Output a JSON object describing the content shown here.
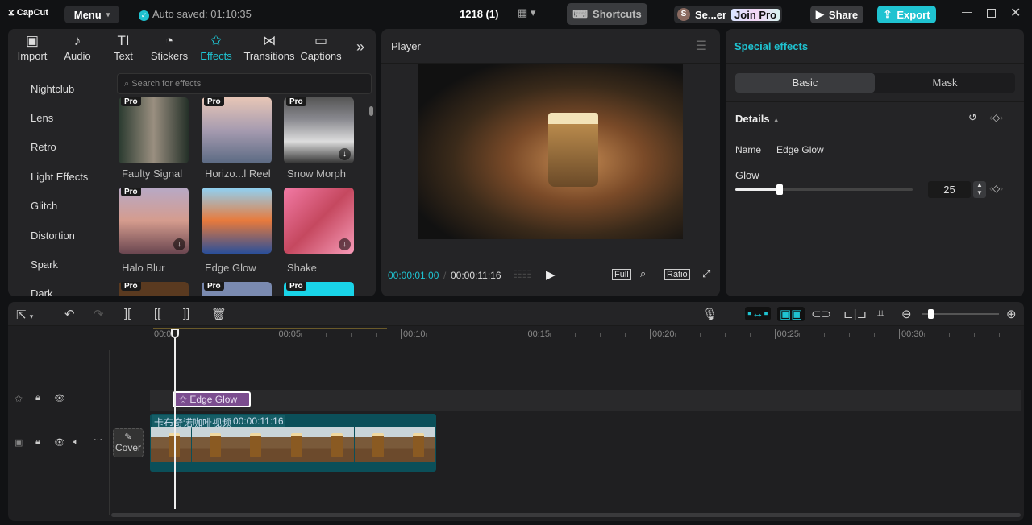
{
  "app": {
    "logo": "CapCut",
    "menu": "Menu",
    "autosave": "Auto saved: 01:10:35",
    "project": "1218 (1)",
    "shortcuts": "Shortcuts",
    "user_initial": "S",
    "user": "Se...er",
    "join_pro": "Join Pro",
    "share": "Share",
    "export": "Export"
  },
  "tabs": [
    {
      "label": "Import",
      "icon": "import-icon"
    },
    {
      "label": "Audio",
      "icon": "audio-icon"
    },
    {
      "label": "Text",
      "icon": "text-icon"
    },
    {
      "label": "Stickers",
      "icon": "sticker-icon"
    },
    {
      "label": "Effects",
      "icon": "effects-icon"
    },
    {
      "label": "Transitions",
      "icon": "transitions-icon"
    },
    {
      "label": "Captions",
      "icon": "captions-icon"
    }
  ],
  "categories": [
    "Nightclub",
    "Lens",
    "Retro",
    "Light Effects",
    "Glitch",
    "Distortion",
    "Spark",
    "Dark"
  ],
  "search_placeholder": "Search for effects",
  "effects": [
    {
      "name": "Faulty Signal",
      "pro": "Pro"
    },
    {
      "name": "Horizo...l Reel",
      "pro": "Pro"
    },
    {
      "name": "Snow Morph",
      "pro": "Pro"
    },
    {
      "name": "Halo Blur",
      "pro": "Pro"
    },
    {
      "name": "Edge Glow",
      "pro": ""
    },
    {
      "name": "Shake",
      "pro": ""
    },
    {
      "name": "",
      "pro": "Pro"
    },
    {
      "name": "",
      "pro": "Pro"
    },
    {
      "name": "",
      "pro": "Pro"
    }
  ],
  "player": {
    "title": "Player",
    "current": "00:00:01:00",
    "sep": "/",
    "total": "00:00:11:16",
    "full": "Full",
    "ratio": "Ratio"
  },
  "inspector": {
    "title": "Special effects",
    "tab_basic": "Basic",
    "tab_mask": "Mask",
    "details": "Details",
    "name_label": "Name",
    "name_value": "Edge Glow",
    "glow_label": "Glow",
    "glow_value": "25",
    "glow_max": 100
  },
  "ruler": [
    "00:00",
    "00:05",
    "00:10",
    "00:15",
    "00:20",
    "00:25",
    "00:30"
  ],
  "timeline": {
    "effect_clip": "Edge Glow",
    "video_title": "卡布奇诺咖啡视频",
    "video_duration": "00:00:11:16",
    "cover": "Cover"
  },
  "colors": {
    "accent": "#1fc3d1",
    "effect_clip": "#7b4d8f",
    "video_clip": "#0b4f59"
  }
}
